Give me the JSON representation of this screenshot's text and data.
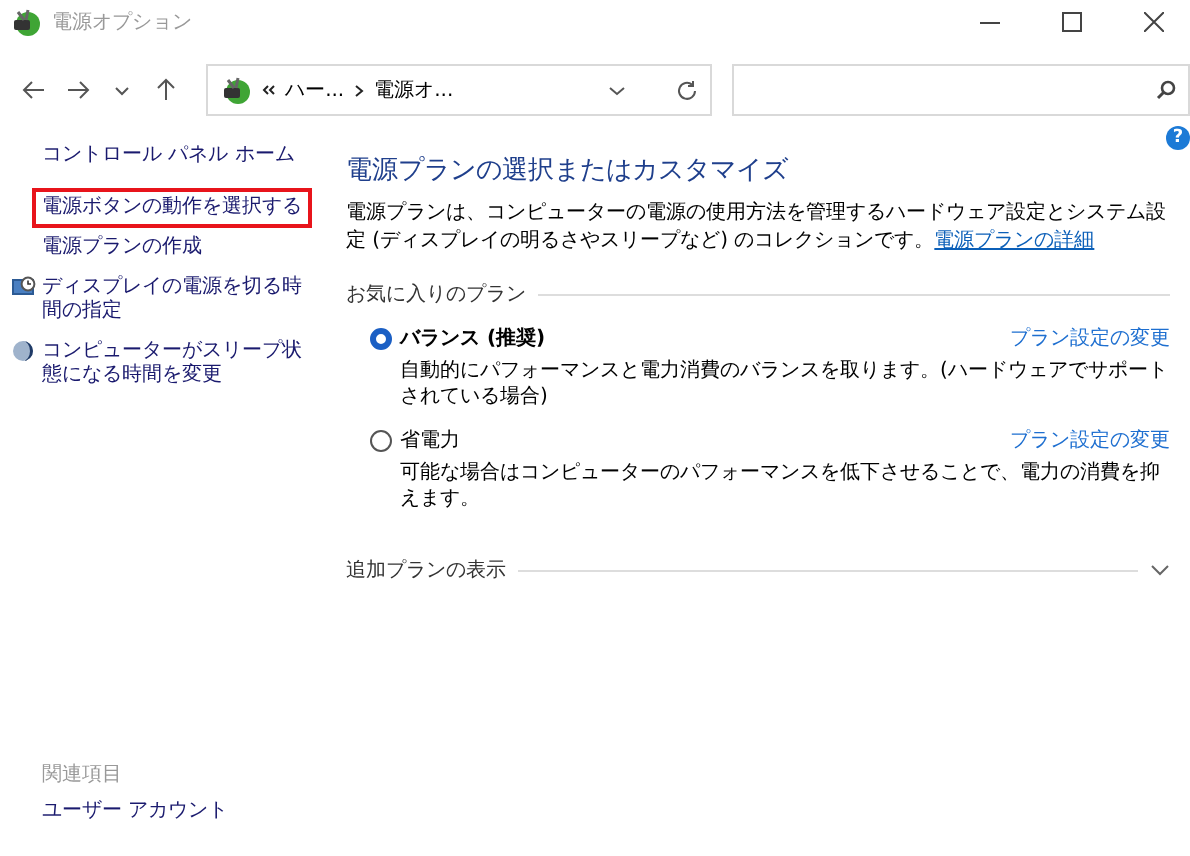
{
  "window": {
    "title": "電源オプション"
  },
  "address": {
    "crumbs": [
      "ハー...",
      "電源オ..."
    ]
  },
  "sidebar": {
    "home_link": "コントロール パネル ホーム",
    "items": [
      {
        "label": "電源ボタンの動作を選択する",
        "kind": "plain",
        "highlighted": true
      },
      {
        "label": "電源プランの作成",
        "kind": "plain",
        "highlighted": false
      },
      {
        "label": "ディスプレイの電源を切る時間の指定",
        "kind": "display",
        "highlighted": false
      },
      {
        "label": "コンピューターがスリープ状態になる時間を変更",
        "kind": "sleep",
        "highlighted": false
      }
    ],
    "see_also_heading": "関連項目",
    "see_also_links": [
      "ユーザー アカウント"
    ]
  },
  "main": {
    "help": "?",
    "heading": "電源プランの選択またはカスタマイズ",
    "description": "電源プランは、コンピューターの電源の使用方法を管理するハードウェア設定とシステム設定 (ディスプレイの明るさやスリープなど) のコレクションです。",
    "details_link": "電源プランの詳細",
    "favorites_label": "お気に入りのプラン",
    "plans": [
      {
        "name": "バランス (推奨)",
        "selected": true,
        "change_link": "プラン設定の変更",
        "description": "自動的にパフォーマンスと電力消費のバランスを取ります。(ハードウェアでサポートされている場合)"
      },
      {
        "name": "省電力",
        "selected": false,
        "change_link": "プラン設定の変更",
        "description": "可能な場合はコンピューターのパフォーマンスを低下させることで、電力の消費を抑えます。"
      }
    ],
    "more_plans": {
      "label": "追加プランの表示",
      "expanded": false
    }
  }
}
